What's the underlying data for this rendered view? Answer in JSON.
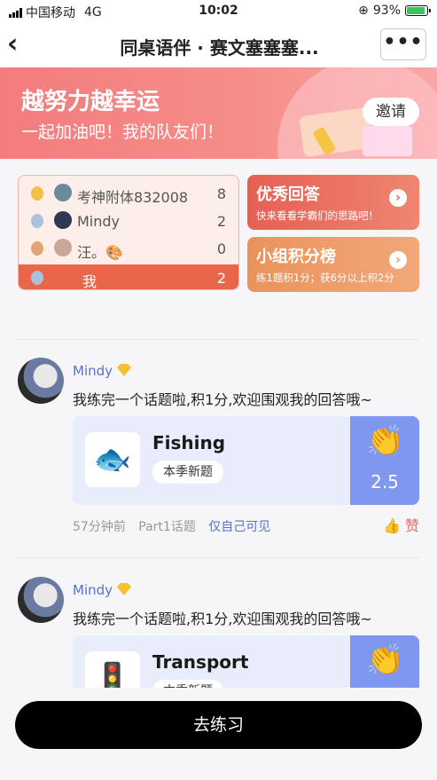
{
  "status_bar": {
    "carrier": "中国移动",
    "network": "4G",
    "time": "10:02",
    "battery": "93%",
    "battery_level": 0.93
  },
  "nav": {
    "back_icon": "chevron-left-icon",
    "title": "同桌语伴 · 赛文塞塞塞...",
    "more_icon": "more-dots-icon"
  },
  "banner": {
    "line1": "越努力越幸运",
    "line2": "一起加油吧！我的队友们！",
    "invite": "邀请"
  },
  "ranking": {
    "rows": [
      {
        "name": "考神附体832008",
        "score": "8",
        "medal": "gold"
      },
      {
        "name": "Mindy",
        "score": "2",
        "medal": "silver"
      },
      {
        "name": "汪。🎨",
        "score": "0",
        "medal": "bronze"
      }
    ],
    "me": {
      "name": "我",
      "score": "2"
    }
  },
  "promo": {
    "excellent": {
      "title": "优秀回答",
      "subtitle": "快来看看学霸们的思路吧！"
    },
    "leaderboard": {
      "title": "小组积分榜",
      "subtitle": "练1题积1分；获6分以上积2分"
    }
  },
  "posts": [
    {
      "user": "Mindy",
      "text": "我练完一个话题啦,积1分,欢迎围观我的回答哦~",
      "card_title": "Fishing",
      "card_tag": "本季新题",
      "score": "2.5",
      "time": "57分钟前",
      "topic": "Part1话题",
      "visibility": "仅自己可见",
      "like": "赞"
    },
    {
      "user": "Mindy",
      "text": "我练完一个话题啦,积1分,欢迎围观我的回答哦~",
      "card_title": "Transport",
      "card_tag": "本季新题"
    }
  ],
  "cta": "去练习"
}
